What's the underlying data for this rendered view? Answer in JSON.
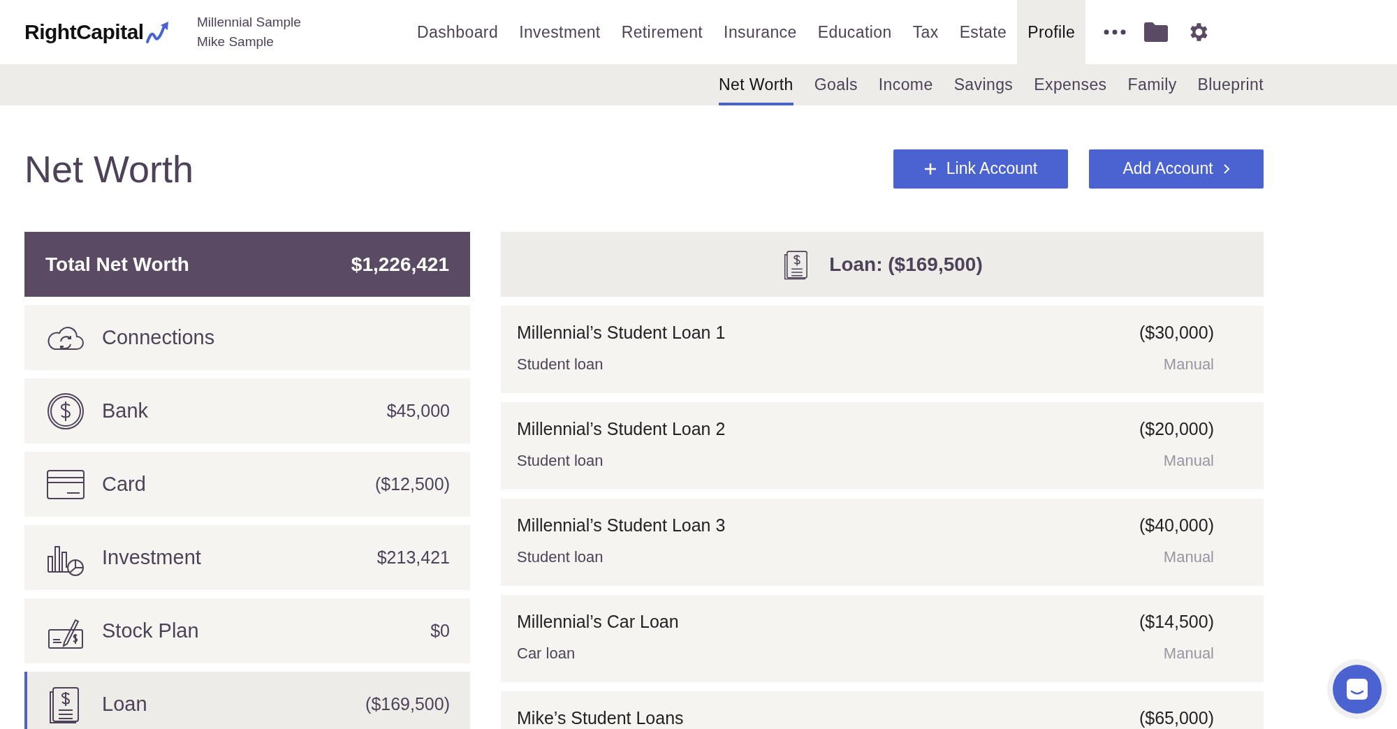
{
  "header": {
    "logo": "RightCapital",
    "client_names": [
      "Millennial Sample",
      "Mike Sample"
    ],
    "nav": [
      {
        "label": "Dashboard",
        "selected": false
      },
      {
        "label": "Investment",
        "selected": false
      },
      {
        "label": "Retirement",
        "selected": false
      },
      {
        "label": "Insurance",
        "selected": false
      },
      {
        "label": "Education",
        "selected": false
      },
      {
        "label": "Tax",
        "selected": false
      },
      {
        "label": "Estate",
        "selected": false
      },
      {
        "label": "Profile",
        "selected": true
      }
    ]
  },
  "subnav": [
    {
      "label": "Net Worth",
      "selected": true
    },
    {
      "label": "Goals",
      "selected": false
    },
    {
      "label": "Income",
      "selected": false
    },
    {
      "label": "Savings",
      "selected": false
    },
    {
      "label": "Expenses",
      "selected": false
    },
    {
      "label": "Family",
      "selected": false
    },
    {
      "label": "Blueprint",
      "selected": false
    }
  ],
  "page_title": "Net Worth",
  "actions": [
    {
      "label": "Link Account",
      "kind": "link"
    },
    {
      "label": "Add Account",
      "kind": "add"
    }
  ],
  "summary": {
    "label": "Total Net Worth",
    "value": "$1,226,421"
  },
  "categories": [
    {
      "kind": "connections",
      "label": "Connections",
      "selected": false
    },
    {
      "kind": "bank",
      "label": "Bank",
      "value": "$45,000",
      "selected": false
    },
    {
      "kind": "card",
      "label": "Card",
      "value": "($12,500)",
      "selected": false
    },
    {
      "kind": "investment",
      "label": "Investment",
      "value": "$213,421",
      "selected": false
    },
    {
      "kind": "stock_plan",
      "label": "Stock Plan",
      "value": "$0",
      "selected": false
    },
    {
      "kind": "loan",
      "label": "Loan",
      "value": "($169,500)",
      "selected": true
    }
  ],
  "detail": {
    "kind": "loan",
    "title": "Loan: ($169,500)",
    "accounts": [
      {
        "name": "Millennial’s Student Loan 1",
        "type": "Student loan",
        "amount": "($30,000)",
        "source": "Manual"
      },
      {
        "name": "Millennial’s Student Loan 2",
        "type": "Student loan",
        "amount": "($20,000)",
        "source": "Manual"
      },
      {
        "name": "Millennial’s Student Loan 3",
        "type": "Student loan",
        "amount": "($40,000)",
        "source": "Manual"
      },
      {
        "name": "Millennial’s Car Loan",
        "type": "Car loan",
        "amount": "($14,500)",
        "source": "Manual"
      },
      {
        "name": "Mike’s Student Loans",
        "amount": "($65,000)"
      }
    ]
  }
}
